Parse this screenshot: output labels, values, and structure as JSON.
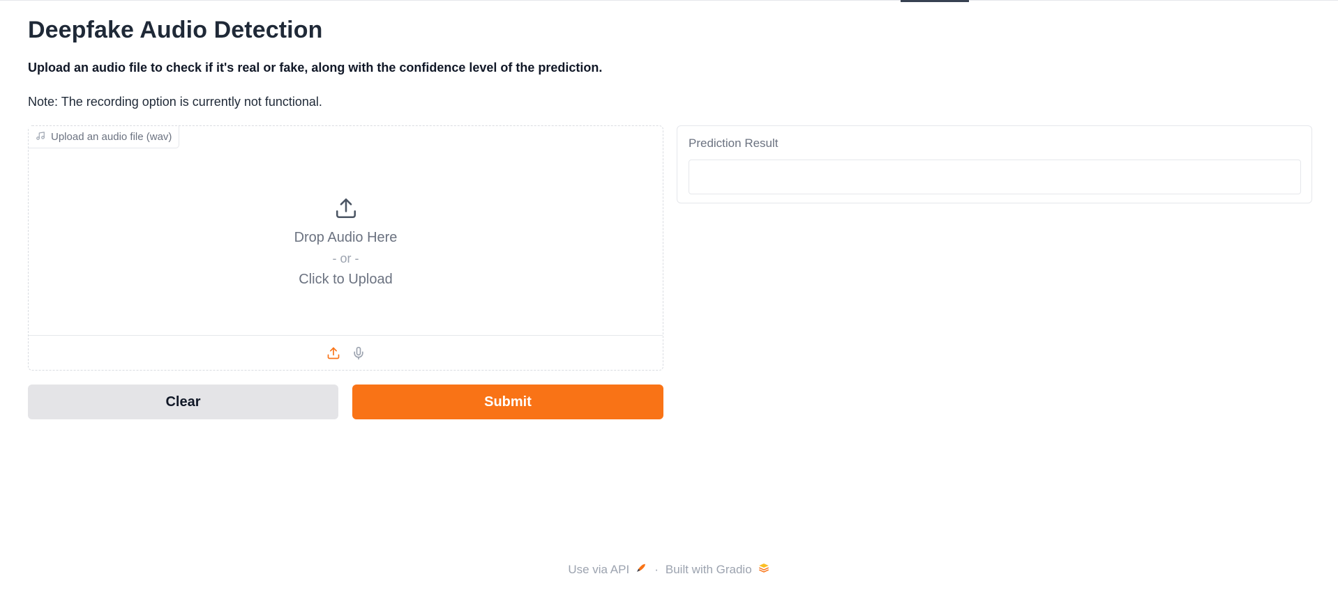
{
  "page": {
    "title": "Deepfake Audio Detection",
    "subtitle": "Upload an audio file to check if it's real or fake, along with the confidence level of the prediction.",
    "note": "Note: The recording option is currently not functional."
  },
  "upload": {
    "label": "Upload an audio file (wav)",
    "label_icon": "music-note-icon",
    "drop_text": "Drop Audio Here",
    "or_text": "- or -",
    "click_text": "Click to Upload",
    "toolbar": [
      {
        "name": "upload-icon",
        "active": true
      },
      {
        "name": "microphone-icon",
        "active": false
      }
    ]
  },
  "buttons": {
    "clear_label": "Clear",
    "submit_label": "Submit"
  },
  "result": {
    "label": "Prediction Result",
    "value": ""
  },
  "footer": {
    "api_label": "Use via API",
    "separator": "·",
    "built_label": "Built with Gradio"
  },
  "colors": {
    "accent": "#f97316",
    "secondary_button": "#e4e4e7",
    "muted_text": "#6b7280"
  }
}
